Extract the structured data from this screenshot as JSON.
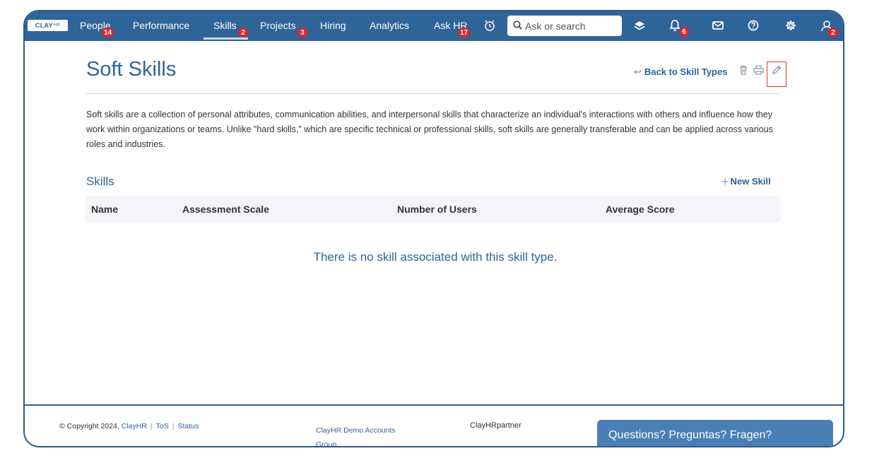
{
  "app": {
    "logo": "CLAY",
    "logo_suffix": "HR",
    "brand_color": "#2f6499",
    "alert_color": "#d9262d"
  },
  "nav": {
    "items": [
      {
        "label": "People",
        "badge": "14"
      },
      {
        "label": "Performance",
        "badge": ""
      },
      {
        "label": "Skills",
        "badge": "2"
      },
      {
        "label": "Projects",
        "badge": "3"
      },
      {
        "label": "Hiring",
        "badge": ""
      },
      {
        "label": "Analytics",
        "badge": ""
      },
      {
        "label": "Ask HR",
        "badge": "17"
      }
    ],
    "active": "Skills",
    "search_placeholder": "Ask or search",
    "notifications_badge": "6",
    "profile_badge": "2",
    "icons": [
      "clock-icon",
      "search-icon",
      "layers-icon",
      "bell-icon",
      "mail-icon",
      "help-icon",
      "settings-icon",
      "profile-icon"
    ]
  },
  "page": {
    "title": "Soft Skills",
    "back_label": "Back to Skill Types",
    "description": "Soft skills are a collection of personal attributes, communication abilities, and interpersonal skills that characterize an individual's interactions with others and influence how they work within organizations or teams. Unlike \"hard skills,\" which are specific technical or professional skills, soft skills are generally transferable and can be applied across various roles and industries."
  },
  "skills": {
    "section_title": "Skills",
    "new_label": "New Skill",
    "columns": [
      "Name",
      "Assessment Scale",
      "Number of Users",
      "Average Score"
    ],
    "empty_message": "There is no skill associated with this skill type."
  },
  "footer": {
    "copyright_prefix": "© Copyright 2024,",
    "company_link": "ClayHR",
    "tos": "ToS",
    "status": "Status",
    "group": "ClayHR Demo Accounts Group",
    "partner": "ClayHRpartner",
    "chat": "Questions? Preguntas? Fragen?"
  }
}
